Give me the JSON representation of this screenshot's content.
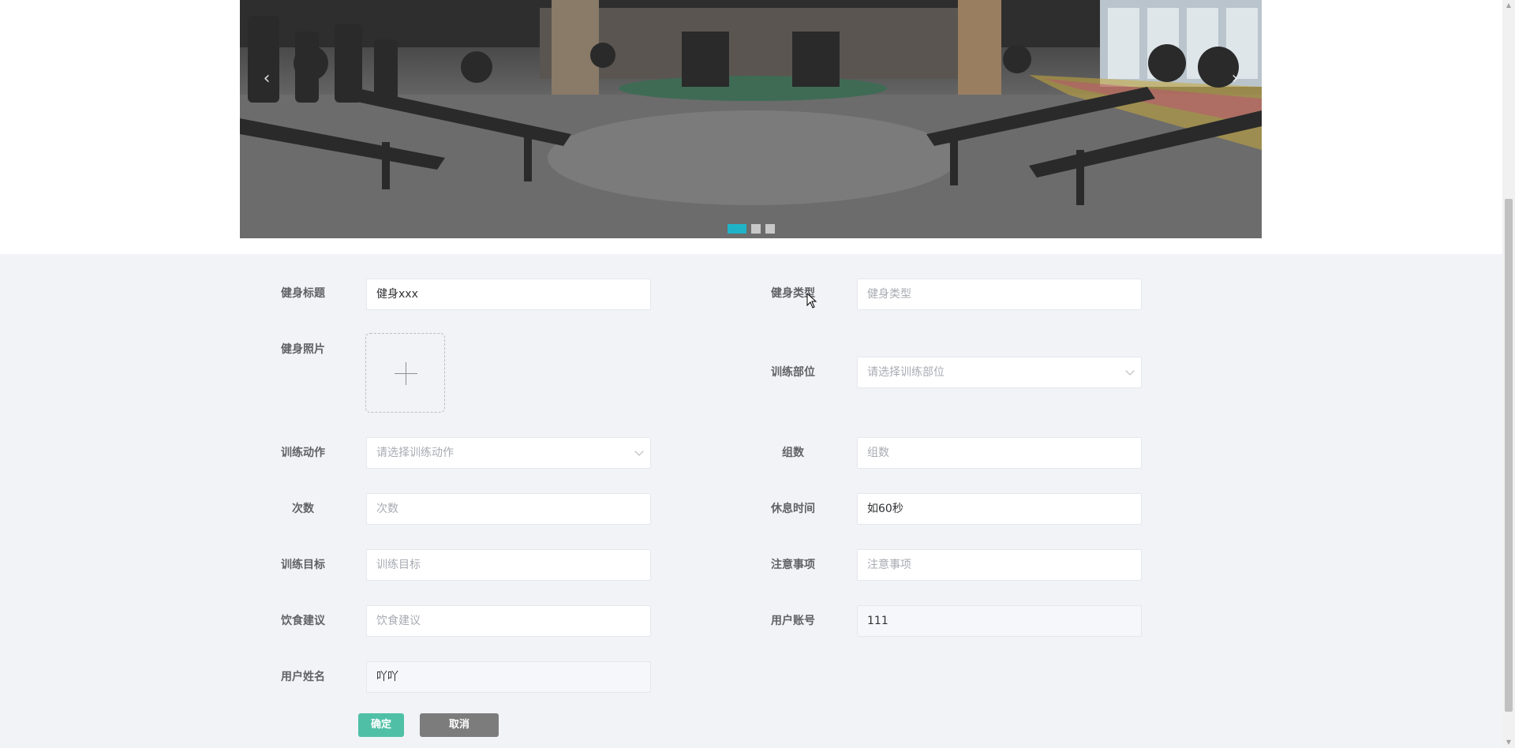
{
  "carousel": {
    "prev_label": "‹",
    "next_label": "›",
    "slide_count": 3,
    "active_index": 0,
    "slide_alt": "gym interior"
  },
  "form": {
    "fitness_title": {
      "label": "健身标题",
      "value": "健身xxx"
    },
    "fitness_type": {
      "label": "健身类型",
      "placeholder": "健身类型"
    },
    "fitness_photo": {
      "label": "健身照片"
    },
    "body_part": {
      "label": "训练部位",
      "placeholder": "请选择训练部位"
    },
    "action": {
      "label": "训练动作",
      "placeholder": "请选择训练动作"
    },
    "sets": {
      "label": "组数",
      "placeholder": "组数"
    },
    "reps": {
      "label": "次数",
      "placeholder": "次数"
    },
    "rest_time": {
      "label": "休息时间",
      "value": "如60秒"
    },
    "goal": {
      "label": "训练目标",
      "placeholder": "训练目标"
    },
    "notes": {
      "label": "注意事项",
      "placeholder": "注意事项"
    },
    "diet": {
      "label": "饮食建议",
      "placeholder": "饮食建议"
    },
    "account": {
      "label": "用户账号",
      "value": "111"
    },
    "user_name": {
      "label": "用户姓名",
      "value": "吖吖"
    }
  },
  "buttons": {
    "confirm": "确定",
    "cancel": "取消"
  },
  "colors": {
    "accent": "#1fb3c8",
    "confirm_button": "#4fc0a6",
    "cancel_button": "#7c7c7c",
    "form_background": "#f2f3f7"
  }
}
